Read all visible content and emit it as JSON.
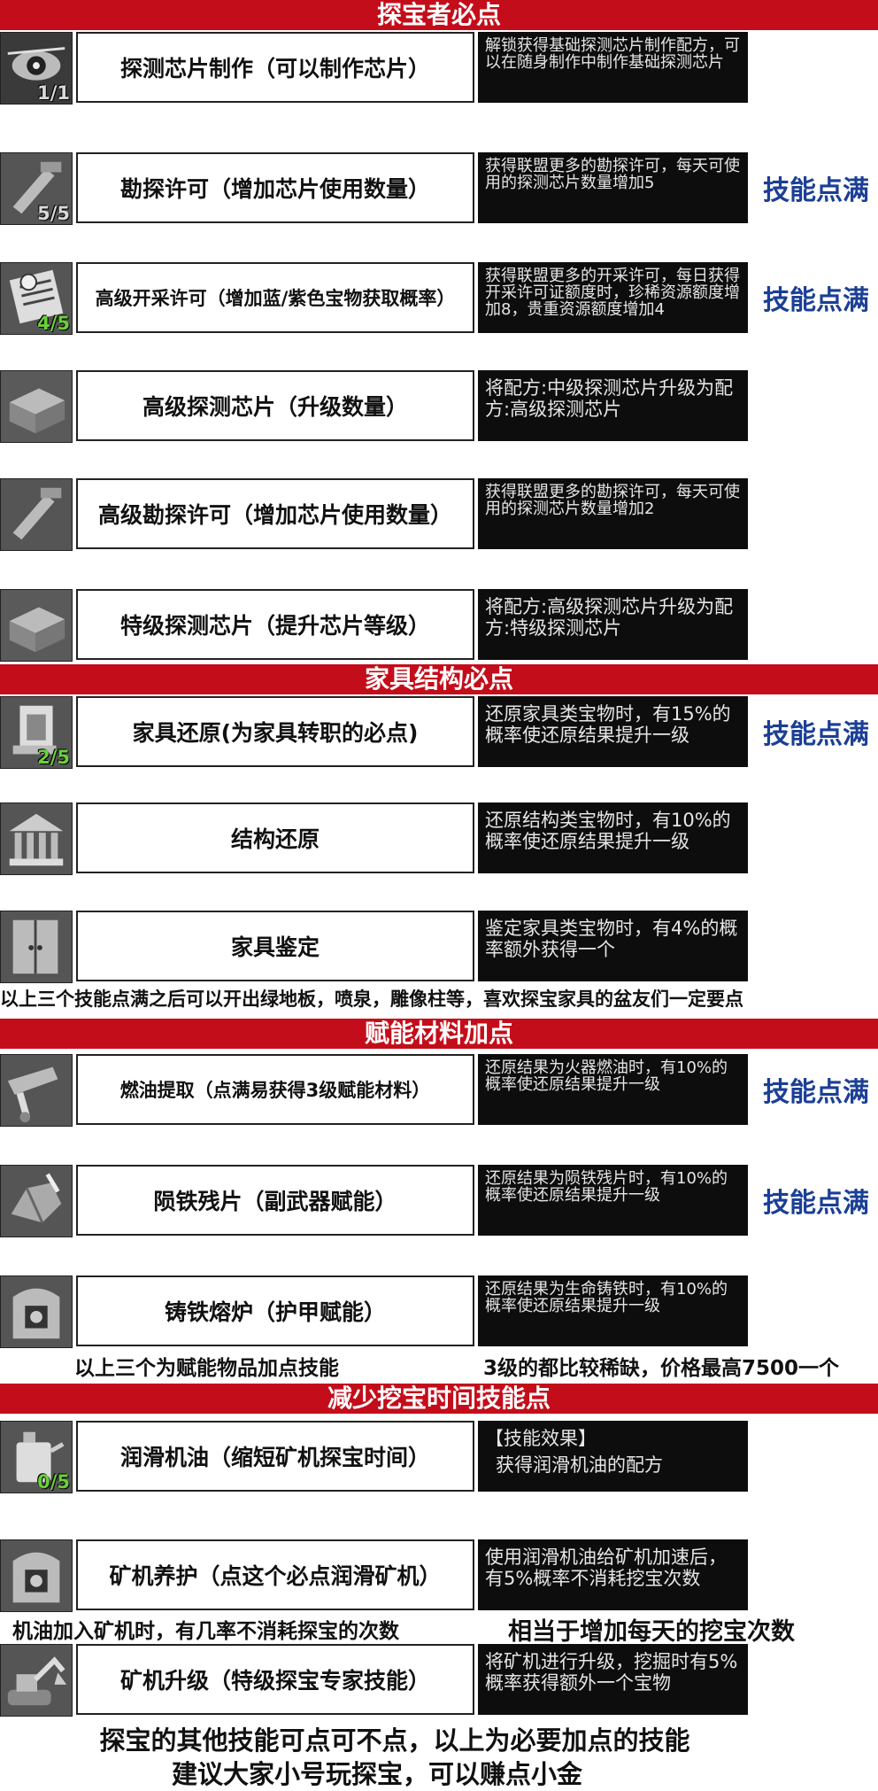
{
  "colors": {
    "banner": "#c40d1a",
    "max_label": "#1b3f95",
    "desc_bg": "#0d0d0d",
    "level_green": "#6ad13a"
  },
  "sections": [
    {
      "title": "探宝者必点",
      "skills": [
        {
          "icon": "eye-icon",
          "name": "探测芯片制作（可以制作芯片）",
          "level": "1/1",
          "desc": "解锁获得基础探测芯片制作配方，可以在随身制作中制作基础探测芯片",
          "max": ""
        },
        {
          "icon": "drill-tool-icon",
          "name": "勘探许可（增加芯片使用数量）",
          "level": "5/5",
          "desc": "获得联盟更多的勘探许可，每天可使用的探测芯片数量增加5",
          "max": "技能点满"
        },
        {
          "icon": "permit-document-icon",
          "name": "高级开采许可（增加蓝/紫色宝物获取概率）",
          "level": "4/5",
          "desc": "获得联盟更多的开采许可，每日获得开采许可证额度时，珍稀资源额度增加8，贵重资源额度增加4",
          "max": "技能点满"
        },
        {
          "icon": "chip-box-icon",
          "name": "高级探测芯片（升级数量）",
          "level": "",
          "desc": "将配方:中级探测芯片升级为配方:高级探测芯片",
          "max": ""
        },
        {
          "icon": "drill-tool-icon",
          "name": "高级勘探许可（增加芯片使用数量）",
          "level": "",
          "desc": "获得联盟更多的勘探许可，每天可使用的探测芯片数量增加2",
          "max": ""
        },
        {
          "icon": "chip-box-icon",
          "name": "特级探测芯片（提升芯片等级）",
          "level": "",
          "desc": "将配方:高级探测芯片升级为配方:特级探测芯片",
          "max": ""
        }
      ]
    },
    {
      "title": "家具结构必点",
      "skills": [
        {
          "icon": "furniture-icon",
          "name": "家具还原(为家具转职的必点)",
          "level": "2/5",
          "desc": "还原家具类宝物时，有15%的概率使还原结果提升一级",
          "max": "技能点满"
        },
        {
          "icon": "building-icon",
          "name": "结构还原",
          "level": "",
          "desc": "还原结构类宝物时，有10%的概率使还原结果提升一级",
          "max": ""
        },
        {
          "icon": "cabinet-icon",
          "name": "家具鉴定",
          "level": "",
          "desc": "鉴定家具类宝物时，有4%的概率额外获得一个",
          "max": ""
        }
      ],
      "note": "以上三个技能点满之后可以开出绿地板，喷泉，雕像柱等，喜欢探宝家具的盆友们一定要点"
    },
    {
      "title": "赋能材料加点",
      "skills": [
        {
          "icon": "fuel-pipe-icon",
          "name": "燃油提取（点满易获得3级赋能材料）",
          "level": "",
          "desc": "还原结果为火器燃油时，有10%的概率使还原结果提升一级",
          "max": "技能点满"
        },
        {
          "icon": "meteor-shard-icon",
          "name": "陨铁残片（副武器赋能）",
          "level": "",
          "desc": "还原结果为陨铁残片时，有10%的概率使还原结果提升一级",
          "max": "技能点满"
        },
        {
          "icon": "furnace-icon",
          "name": "铸铁熔炉（护甲赋能）",
          "level": "",
          "desc": "还原结果为生命铸铁时，有10%的概率使还原结果提升一级",
          "max": ""
        }
      ],
      "note_left": "以上三个为赋能物品加点技能",
      "note_right": "3级的都比较稀缺，价格最高7500一个"
    },
    {
      "title": "减少挖宝时间技能点",
      "skills": [
        {
          "icon": "oil-can-icon",
          "name": "润滑机油（缩短矿机探宝时间）",
          "level": "0/5",
          "desc_line1": "【技能效果】",
          "desc_line2": "获得润滑机油的配方",
          "max": ""
        },
        {
          "icon": "furnace-icon",
          "name": "矿机养护（点这个必点润滑矿机）",
          "level": "",
          "desc": "使用润滑机油给矿机加速后，有5%概率不消耗挖宝次数",
          "max": ""
        },
        {
          "icon": "excavator-icon",
          "name": "矿机升级（特级探宝专家技能）",
          "level": "",
          "desc": "将矿机进行升级，挖掘时有5%概率获得额外一个宝物",
          "max": ""
        }
      ],
      "note_left": "机油加入矿机时，有几率不消耗探宝的次数",
      "note_right": "相当于增加每天的挖宝次数"
    }
  ],
  "footer": {
    "line1": "探宝的其他技能可点可不点，以上为必要加点的技能",
    "line2": "建议大家小号玩探宝，可以赚点小金"
  }
}
